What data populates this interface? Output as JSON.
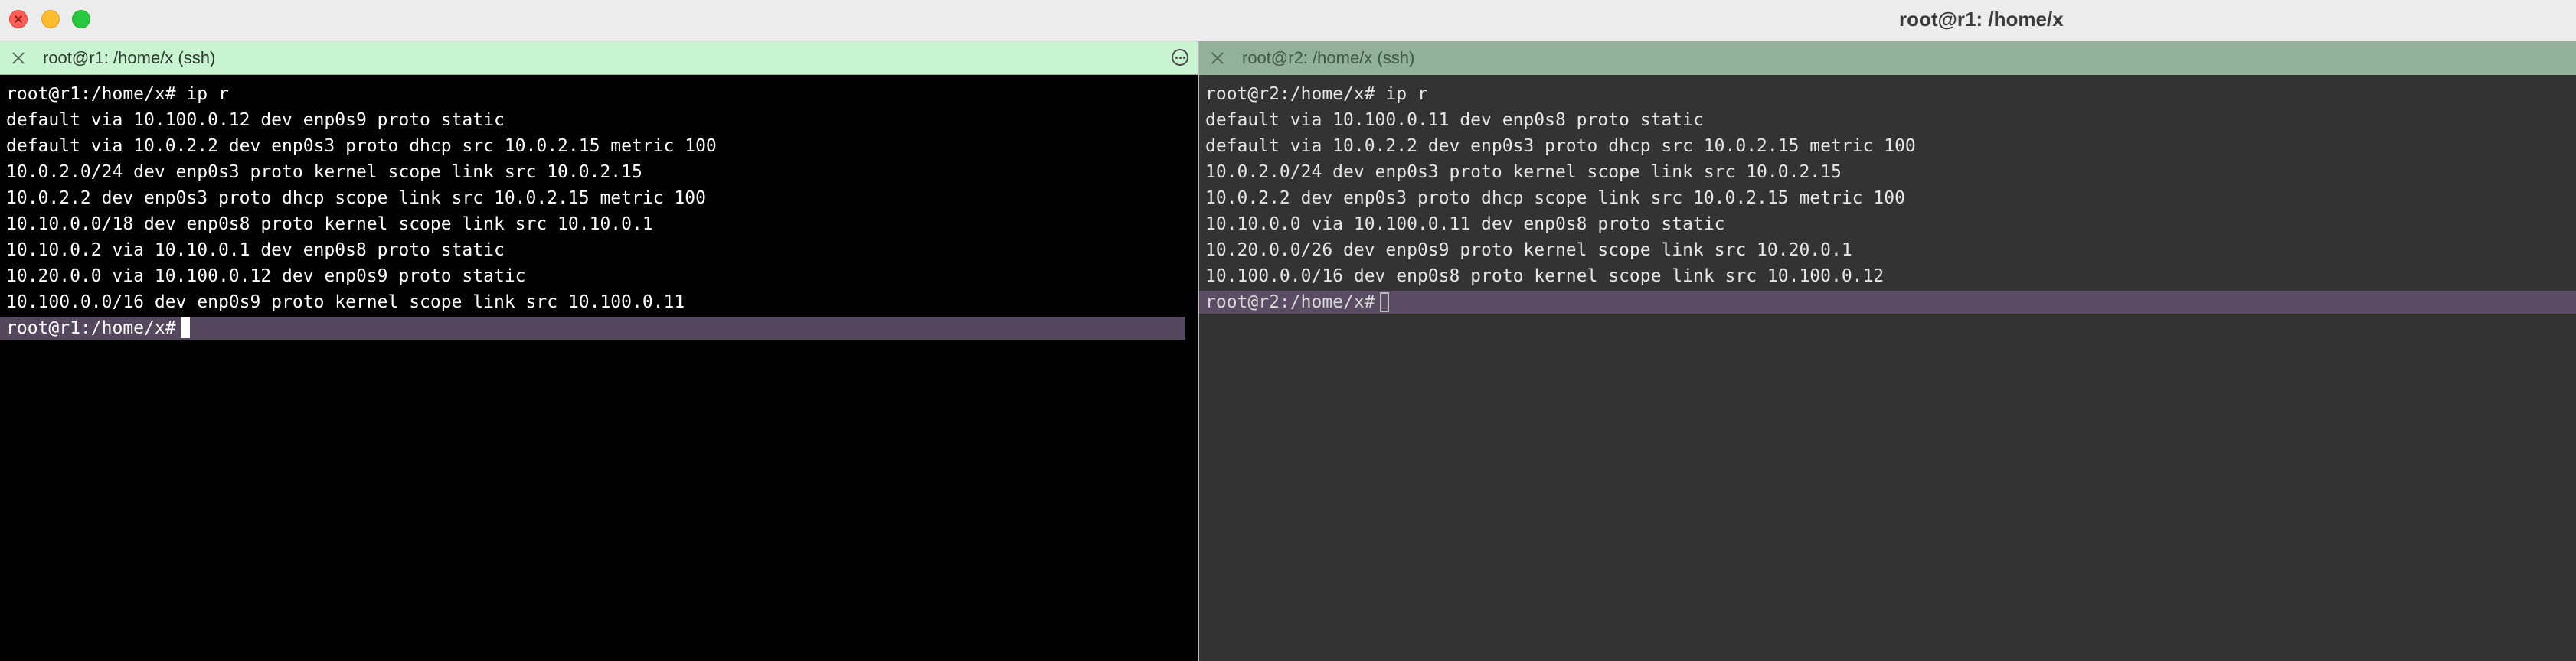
{
  "window": {
    "title": "root@r1: /home/x"
  },
  "colors": {
    "left_tab_bg": "#c8f4d2",
    "right_tab_bg": "#93b19a",
    "left_pane_bg": "#000000",
    "right_pane_bg": "#333333",
    "prompt_highlight": "#54475e"
  },
  "panes": {
    "left": {
      "tab_title": "root@r1: /home/x (ssh)",
      "close_icon": "close-icon",
      "more_icon": "ellipsis-circle-icon",
      "lines": [
        "root@r1:/home/x# ip r",
        "default via 10.100.0.12 dev enp0s9 proto static",
        "default via 10.0.2.2 dev enp0s3 proto dhcp src 10.0.2.15 metric 100",
        "10.0.2.0/24 dev enp0s3 proto kernel scope link src 10.0.2.15",
        "10.0.2.2 dev enp0s3 proto dhcp scope link src 10.0.2.15 metric 100",
        "10.10.0.0/18 dev enp0s8 proto kernel scope link src 10.10.0.1",
        "10.10.0.2 via 10.10.0.1 dev enp0s8 proto static",
        "10.20.0.0 via 10.100.0.12 dev enp0s9 proto static",
        "10.100.0.0/16 dev enp0s9 proto kernel scope link src 10.100.0.11"
      ],
      "prompt": "root@r1:/home/x#"
    },
    "right": {
      "tab_title": "root@r2: /home/x (ssh)",
      "close_icon": "close-icon",
      "lines": [
        "root@r2:/home/x# ip r",
        "default via 10.100.0.11 dev enp0s8 proto static",
        "default via 10.0.2.2 dev enp0s3 proto dhcp src 10.0.2.15 metric 100",
        "10.0.2.0/24 dev enp0s3 proto kernel scope link src 10.0.2.15",
        "10.0.2.2 dev enp0s3 proto dhcp scope link src 10.0.2.15 metric 100",
        "10.10.0.0 via 10.100.0.11 dev enp0s8 proto static",
        "10.20.0.0/26 dev enp0s9 proto kernel scope link src 10.20.0.1",
        "10.100.0.0/16 dev enp0s8 proto kernel scope link src 10.100.0.12"
      ],
      "prompt": "root@r2:/home/x#"
    }
  }
}
